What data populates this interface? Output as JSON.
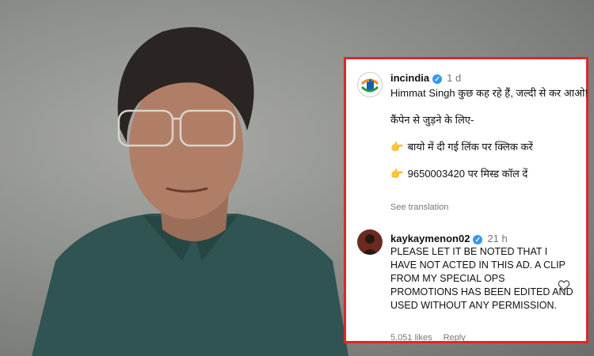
{
  "post": {
    "username": "incindia",
    "time": "1 d",
    "line1": "Himmat Singh कुछ कह रहे हैं, जल्दी से कर आओ!",
    "line2": "कैंपेन से जुड़ने के लिए-",
    "item1": "बायो में दी गई लिंक पर क्लिक करें",
    "item2": "9650003420 पर मिस्ड कॉल दें",
    "hand_icon": "pointing-hand-icon",
    "see_translation": "See translation"
  },
  "comment": {
    "username": "kaykaymenon02",
    "time": "21 h",
    "text": "PLEASE LET IT BE NOTED THAT I HAVE NOT ACTED IN THIS AD. A CLIP FROM MY SPECIAL OPS PROMOTIONS HAS BEEN EDITED AND USED WITHOUT ANY PERMISSION.",
    "likes": "5,051 likes",
    "reply": "Reply"
  },
  "colors": {
    "border": "#e0262b",
    "verified": "#3797f0"
  }
}
